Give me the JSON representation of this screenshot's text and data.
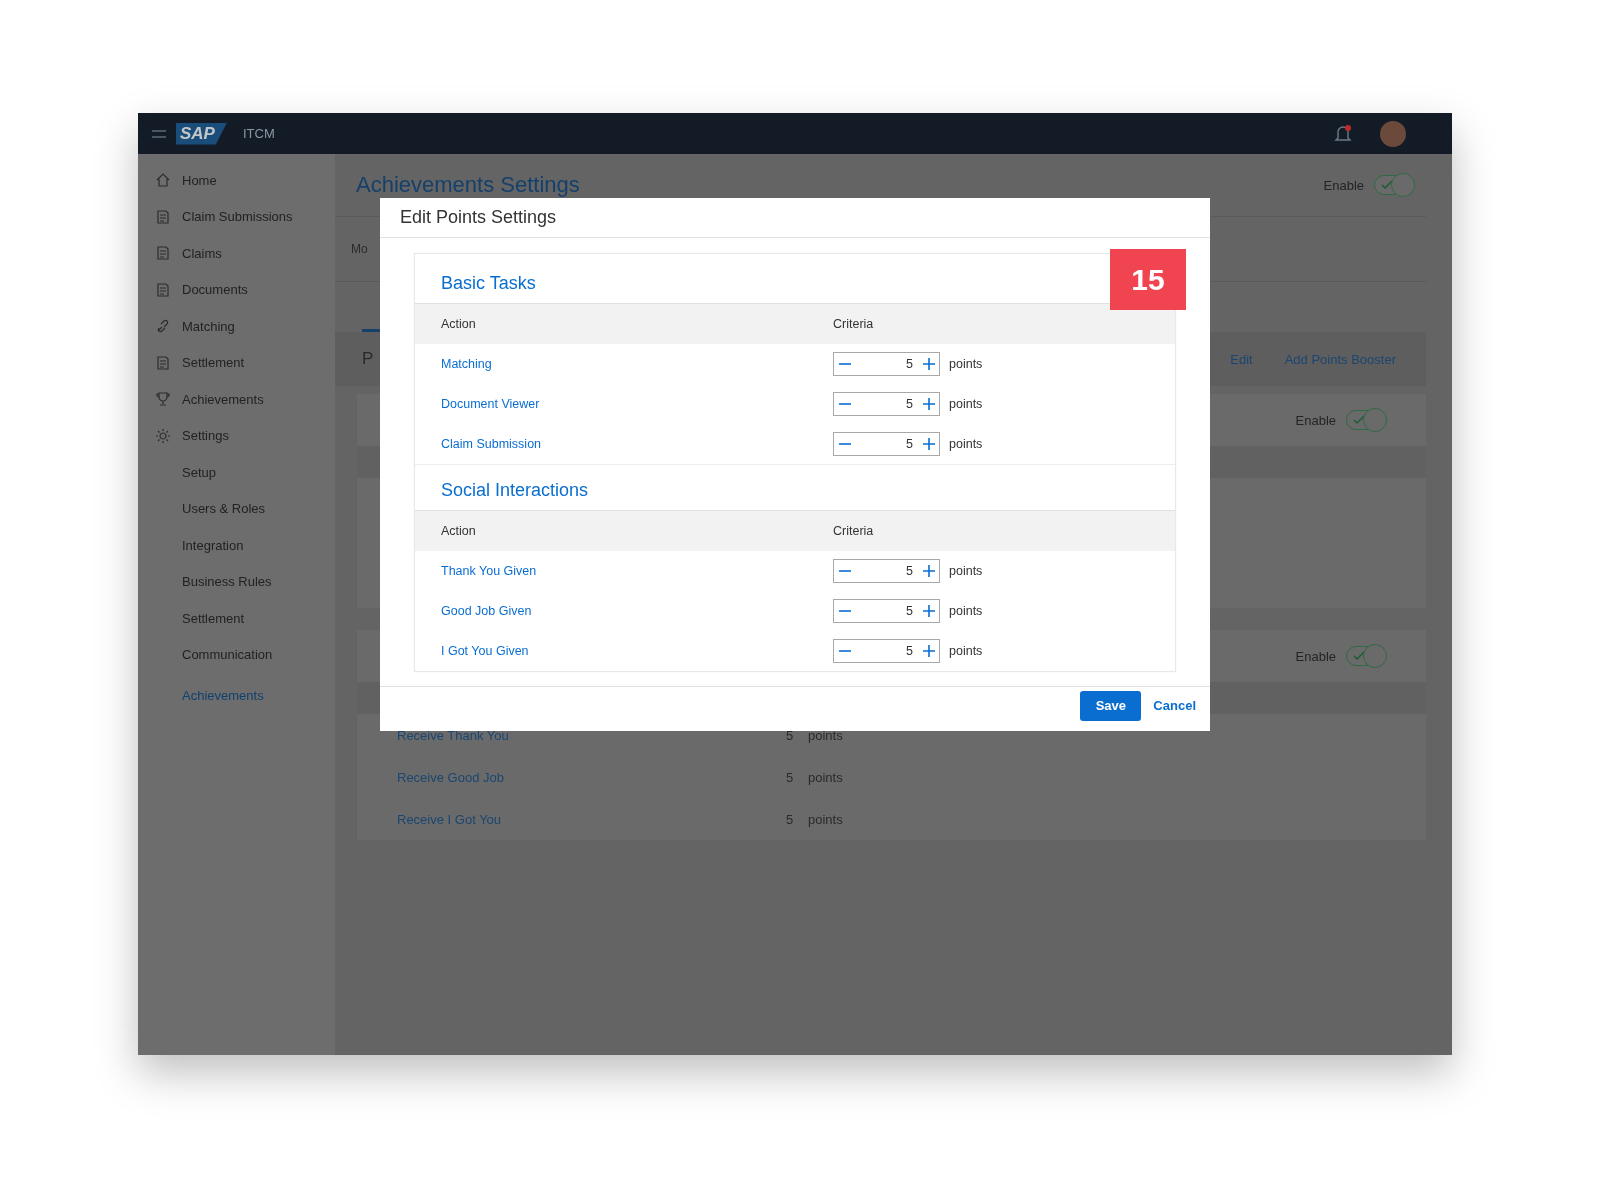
{
  "shell": {
    "logo": "SAP",
    "product": "ITCM",
    "has_unread": true
  },
  "sidebar": {
    "items": [
      {
        "label": "Home",
        "selected": false
      },
      {
        "label": "Claim Submissions",
        "selected": false
      },
      {
        "label": "Claims",
        "selected": false
      },
      {
        "label": "Documents",
        "selected": false
      },
      {
        "label": "Matching",
        "selected": false
      },
      {
        "label": "Settlement",
        "selected": false
      },
      {
        "label": "Achievements",
        "selected": false
      },
      {
        "label": "Settings",
        "selected": false,
        "children": [
          {
            "label": "Setup",
            "selected": false
          },
          {
            "label": "Users & Roles",
            "selected": false
          },
          {
            "label": "Integration",
            "selected": false
          },
          {
            "label": "Business Rules",
            "selected": false
          },
          {
            "label": "Settlement",
            "selected": false
          },
          {
            "label": "Communication",
            "selected": false
          },
          {
            "label": "Achievements",
            "selected": true
          }
        ]
      }
    ]
  },
  "page": {
    "title": "Achievements Settings",
    "enable": {
      "label": "Enable",
      "on": true
    },
    "subtitle": "Mo",
    "tab": "P",
    "actions": [
      "Edit",
      "Add Points Booster"
    ],
    "panels": [
      {
        "enable": {
          "label": "Enable",
          "on": true
        }
      },
      {
        "enable": {
          "label": "Enable",
          "on": true
        },
        "rows": [
          {
            "action": "Receive Thank You",
            "value": "5",
            "unit": "points"
          },
          {
            "action": "Receive Good Job",
            "value": "5",
            "unit": "points"
          },
          {
            "action": "Receive I Got You",
            "value": "5",
            "unit": "points"
          }
        ]
      }
    ]
  },
  "dialog": {
    "title": "Edit Points Settings",
    "badge": "15",
    "sections": [
      {
        "title": "Basic Tasks",
        "columns": [
          "Action",
          "Criteria"
        ],
        "rows": [
          {
            "action": "Matching",
            "value": "5",
            "unit": "points"
          },
          {
            "action": "Document Viewer",
            "value": "5",
            "unit": "points"
          },
          {
            "action": "Claim Submission",
            "value": "5",
            "unit": "points"
          }
        ]
      },
      {
        "title": "Social Interactions",
        "columns": [
          "Action",
          "Criteria"
        ],
        "rows": [
          {
            "action": "Thank You Given",
            "value": "5",
            "unit": "points"
          },
          {
            "action": "Good Job Given",
            "value": "5",
            "unit": "points"
          },
          {
            "action": "I Got You Given",
            "value": "5",
            "unit": "points"
          }
        ]
      }
    ],
    "save": "Save",
    "cancel": "Cancel"
  }
}
